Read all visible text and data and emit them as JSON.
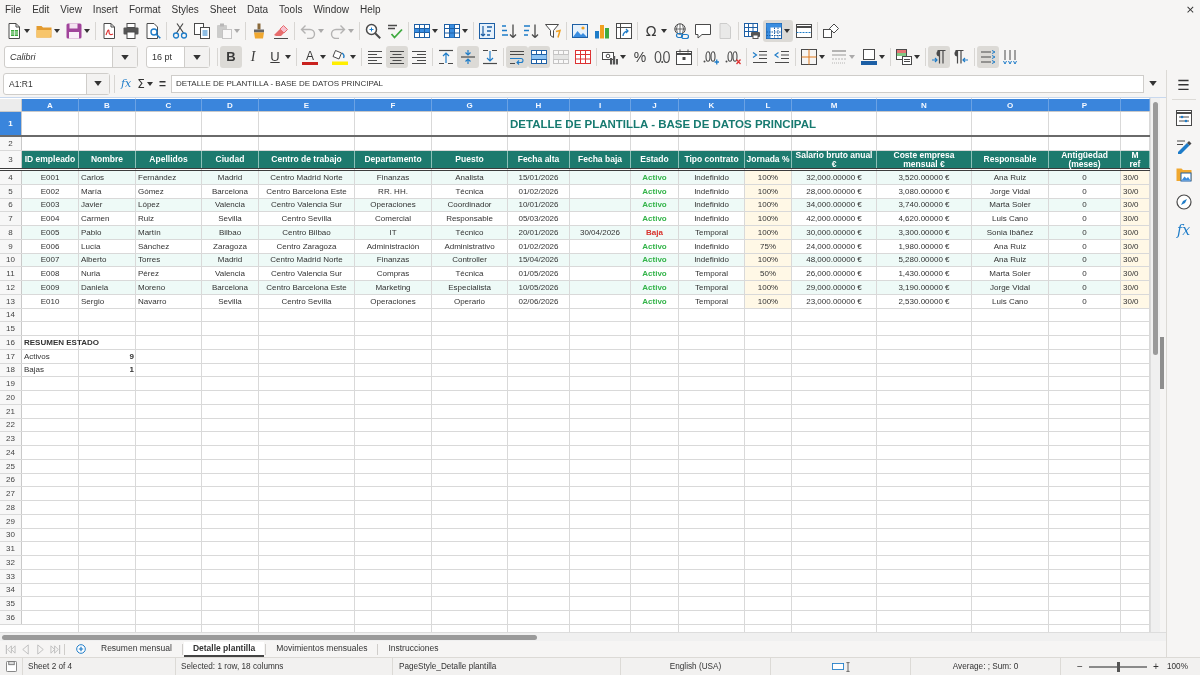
{
  "menu_bar": {
    "items": [
      "File",
      "Edit",
      "View",
      "Insert",
      "Format",
      "Styles",
      "Sheet",
      "Data",
      "Tools",
      "Window",
      "Help"
    ],
    "close": "×"
  },
  "standard_toolbar": [
    [
      {
        "kind": "new",
        "selected": false,
        "disabled": false
      },
      {
        "kind": "open",
        "selected": false,
        "disabled": false
      },
      {
        "kind": "save",
        "selected": false,
        "disabled": false
      }
    ],
    [
      {
        "kind": "pdf",
        "selected": false,
        "disabled": false
      },
      {
        "kind": "print",
        "selected": false,
        "disabled": false
      },
      {
        "kind": "preview",
        "selected": false,
        "disabled": false
      }
    ],
    [
      {
        "kind": "cut",
        "selected": false,
        "disabled": false
      },
      {
        "kind": "copy",
        "selected": false,
        "disabled": false
      },
      {
        "kind": "paste",
        "selected": false,
        "disabled": true
      }
    ],
    [
      {
        "kind": "clone",
        "selected": false,
        "disabled": false
      },
      {
        "kind": "clear",
        "selected": false,
        "disabled": false
      }
    ],
    [
      {
        "kind": "undo",
        "selected": false,
        "disabled": true
      },
      {
        "kind": "redo",
        "selected": false,
        "disabled": true
      }
    ],
    [
      {
        "kind": "find",
        "selected": false,
        "disabled": false
      },
      {
        "kind": "spelling",
        "selected": false,
        "disabled": false
      }
    ],
    [
      {
        "kind": "rows",
        "selected": false,
        "disabled": false
      },
      {
        "kind": "columns",
        "selected": false,
        "disabled": false
      }
    ],
    [
      {
        "kind": "sort",
        "selected": false,
        "disabled": false
      },
      {
        "kind": "ascending",
        "selected": false,
        "disabled": false
      },
      {
        "kind": "descending",
        "selected": false,
        "disabled": false
      },
      {
        "kind": "autofilter",
        "selected": false,
        "disabled": false
      }
    ],
    [
      {
        "kind": "image",
        "selected": false,
        "disabled": false
      },
      {
        "kind": "chart",
        "selected": false,
        "disabled": false
      },
      {
        "kind": "pivot",
        "selected": false,
        "disabled": false
      }
    ],
    [
      {
        "kind": "symbol",
        "glyph": "Ω",
        "selected": false,
        "disabled": false
      },
      {
        "kind": "hyperlink",
        "selected": false,
        "disabled": false
      },
      {
        "kind": "comment",
        "selected": false,
        "disabled": false
      },
      {
        "kind": "headerfooter",
        "selected": false,
        "disabled": true
      }
    ],
    [
      {
        "kind": "printarea",
        "selected": false,
        "disabled": false
      },
      {
        "kind": "freeze",
        "selected": true,
        "disabled": false
      },
      {
        "kind": "split",
        "selected": false,
        "disabled": false
      }
    ],
    [
      {
        "kind": "shapes",
        "selected": false,
        "disabled": false
      }
    ]
  ],
  "formatting_toolbar": {
    "font_name": "Calibri",
    "font_size": "16 pt",
    "groups": [
      [
        {
          "kind": "bold",
          "glyph": "B",
          "selected": true,
          "disabled": false
        },
        {
          "kind": "italic",
          "glyph": "I",
          "selected": false,
          "disabled": false
        },
        {
          "kind": "underline",
          "glyph": "U",
          "selected": false,
          "disabled": false
        }
      ],
      [
        {
          "kind": "fontcolor",
          "glyph": "A",
          "selected": false,
          "disabled": false
        },
        {
          "kind": "highlight",
          "selected": false,
          "disabled": false
        }
      ],
      [
        {
          "kind": "left",
          "selected": false,
          "disabled": false
        },
        {
          "kind": "center",
          "selected": true,
          "disabled": false
        },
        {
          "kind": "right",
          "selected": false,
          "disabled": false
        }
      ],
      [
        {
          "kind": "top",
          "selected": false,
          "disabled": false
        },
        {
          "kind": "middle",
          "selected": true,
          "disabled": false
        },
        {
          "kind": "bottom",
          "selected": false,
          "disabled": false
        }
      ],
      [
        {
          "kind": "wrap",
          "selected": true,
          "disabled": false
        },
        {
          "kind": "mergecenter",
          "selected": true,
          "disabled": false
        },
        {
          "kind": "merge",
          "selected": false,
          "disabled": true
        },
        {
          "kind": "unmerge",
          "selected": false,
          "disabled": false
        }
      ],
      [
        {
          "kind": "currency",
          "selected": false,
          "disabled": false
        },
        {
          "kind": "percent",
          "glyph": "%",
          "selected": false,
          "disabled": false
        },
        {
          "kind": "number",
          "selected": false,
          "disabled": false
        },
        {
          "kind": "date",
          "selected": false,
          "disabled": false
        }
      ],
      [
        {
          "kind": "adddecimal",
          "selected": false,
          "disabled": false
        },
        {
          "kind": "deletedecimal",
          "selected": false,
          "disabled": false
        }
      ],
      [
        {
          "kind": "indent",
          "selected": false,
          "disabled": false
        },
        {
          "kind": "outdent",
          "selected": false,
          "disabled": false
        }
      ],
      [
        {
          "kind": "borders",
          "selected": false,
          "disabled": false
        },
        {
          "kind": "borderstyle",
          "selected": false,
          "disabled": true
        },
        {
          "kind": "bordercolor",
          "selected": false,
          "disabled": false
        }
      ],
      [
        {
          "kind": "conditional",
          "selected": false,
          "disabled": false
        }
      ],
      [
        {
          "kind": "ltr",
          "selected": true,
          "disabled": false
        },
        {
          "kind": "rtl",
          "selected": false,
          "disabled": false
        }
      ],
      [
        {
          "kind": "horizontal",
          "selected": true,
          "disabled": false
        },
        {
          "kind": "vertical",
          "selected": false,
          "disabled": false
        }
      ]
    ]
  },
  "formula_bar": {
    "name_box": "A1:R1",
    "buttons": [
      {
        "kind": "function",
        "glyph": "fx"
      },
      {
        "kind": "sum",
        "glyph": "Σ"
      },
      {
        "kind": "formula",
        "glyph": "="
      }
    ],
    "content": "DETALLE DE PLANTILLA - BASE DE DATOS PRINCIPAL"
  },
  "sheet": {
    "column_headers": [
      {
        "label": "A",
        "selected": true
      },
      {
        "label": "B",
        "selected": true
      },
      {
        "label": "C",
        "selected": true
      },
      {
        "label": "D",
        "selected": true
      },
      {
        "label": "E",
        "selected": true
      },
      {
        "label": "F",
        "selected": true
      },
      {
        "label": "G",
        "selected": true
      },
      {
        "label": "H",
        "selected": true
      },
      {
        "label": "I",
        "selected": true
      },
      {
        "label": "J",
        "selected": true
      },
      {
        "label": "K",
        "selected": true
      },
      {
        "label": "L",
        "selected": true
      },
      {
        "label": "M",
        "selected": true
      },
      {
        "label": "N",
        "selected": true
      },
      {
        "label": "O",
        "selected": true
      },
      {
        "label": "P",
        "selected": true
      }
    ],
    "row_headers": [
      {
        "label": "1",
        "selected": true
      },
      {
        "label": "2",
        "selected": false
      },
      {
        "label": "3",
        "selected": false
      },
      {
        "label": "4",
        "selected": false
      },
      {
        "label": "5",
        "selected": false
      },
      {
        "label": "6",
        "selected": false
      },
      {
        "label": "7",
        "selected": false
      },
      {
        "label": "8",
        "selected": false
      },
      {
        "label": "9",
        "selected": false
      },
      {
        "label": "10",
        "selected": false
      },
      {
        "label": "11",
        "selected": false
      },
      {
        "label": "12",
        "selected": false
      },
      {
        "label": "13",
        "selected": false
      },
      {
        "label": "14",
        "selected": false
      },
      {
        "label": "15",
        "selected": false
      },
      {
        "label": "16",
        "selected": false
      },
      {
        "label": "17",
        "selected": false
      },
      {
        "label": "18",
        "selected": false
      },
      {
        "label": "19",
        "selected": false
      },
      {
        "label": "20",
        "selected": false
      },
      {
        "label": "21",
        "selected": false
      },
      {
        "label": "22",
        "selected": false
      },
      {
        "label": "23",
        "selected": false
      },
      {
        "label": "24",
        "selected": false
      },
      {
        "label": "25",
        "selected": false
      },
      {
        "label": "26",
        "selected": false
      },
      {
        "label": "27",
        "selected": false
      },
      {
        "label": "28",
        "selected": false
      },
      {
        "label": "29",
        "selected": false
      },
      {
        "label": "30",
        "selected": false
      },
      {
        "label": "31",
        "selected": false
      },
      {
        "label": "32",
        "selected": false
      },
      {
        "label": "33",
        "selected": false
      },
      {
        "label": "34",
        "selected": false
      },
      {
        "label": "35",
        "selected": false
      },
      {
        "label": "36",
        "selected": false
      }
    ],
    "title": "DETALLE DE PLANTILLA - BASE DE DATOS PRINCIPAL",
    "table": {
      "columns": [
        "ID empleado",
        "Nombre",
        "Apellidos",
        "Ciudad",
        "Centro de trabajo",
        "Departamento",
        "Puesto",
        "Fecha alta",
        "Fecha baja",
        "Estado",
        "Tipo contrato",
        "Jornada %",
        "Salario bruto anual €",
        "Coste empresa mensual €",
        "Responsable",
        "Antigüedad (meses)",
        "M\nref"
      ],
      "rows": [
        {
          "id": "E001",
          "nombre": "Carlos",
          "apellidos": "Fernández",
          "ciudad": "Madrid",
          "centro_trabajo": "Centro Madrid Norte",
          "departamento": "Finanzas",
          "puesto": "Analista",
          "fecha_alta": "15/01/2026",
          "estado": {
            "label": "Activo",
            "color": "#34b44a"
          },
          "tipo_contrato": "Indefinido",
          "jornada": "100%",
          "salario_bruto_anual": "32,000.00000 €",
          "coste_empresa_mensual": "3,520.00000 €",
          "responsable": "Ana Ruiz",
          "antiguedad": "0",
          "column_17": "30/0"
        },
        {
          "id": "E002",
          "nombre": "María",
          "apellidos": "Gómez",
          "ciudad": "Barcelona",
          "centro_trabajo": "Centro Barcelona Este",
          "departamento": "RR. HH.",
          "puesto": "Técnica",
          "fecha_alta": "01/02/2026",
          "estado": {
            "label": "Activo",
            "color": "#34b44a"
          },
          "tipo_contrato": "Indefinido",
          "jornada": "100%",
          "salario_bruto_anual": "28,000.00000 €",
          "coste_empresa_mensual": "3,080.00000 €",
          "responsable": "Jorge Vidal",
          "antiguedad": "0",
          "column_17": "30/0"
        },
        {
          "id": "E003",
          "nombre": "Javier",
          "apellidos": "López",
          "ciudad": "Valencia",
          "centro_trabajo": "Centro Valencia Sur",
          "departamento": "Operaciones",
          "puesto": "Coordinador",
          "fecha_alta": "10/01/2026",
          "estado": {
            "label": "Activo",
            "color": "#34b44a"
          },
          "tipo_contrato": "Indefinido",
          "jornada": "100%",
          "salario_bruto_anual": "34,000.00000 €",
          "coste_empresa_mensual": "3,740.00000 €",
          "responsable": "Marta Soler",
          "antiguedad": "0",
          "column_17": "30/0"
        },
        {
          "id": "E004",
          "nombre": "Carmen",
          "apellidos": "Ruiz",
          "ciudad": "Sevilla",
          "centro_trabajo": "Centro Sevilla",
          "departamento": "Comercial",
          "puesto": "Responsable",
          "fecha_alta": "05/03/2026",
          "estado": {
            "label": "Activo",
            "color": "#34b44a"
          },
          "tipo_contrato": "Indefinido",
          "jornada": "100%",
          "salario_bruto_anual": "42,000.00000 €",
          "coste_empresa_mensual": "4,620.00000 €",
          "responsable": "Luis Cano",
          "antiguedad": "0",
          "column_17": "30/0"
        },
        {
          "id": "E005",
          "nombre": "Pablo",
          "apellidos": "Martín",
          "ciudad": "Bilbao",
          "centro_trabajo": "Centro Bilbao",
          "departamento": "IT",
          "puesto": "Técnico",
          "fecha_alta": "20/01/2026",
          "fecha_baja": "30/04/2026",
          "estado": {
            "label": "Baja",
            "color": "#d8312b"
          },
          "tipo_contrato": "Temporal",
          "jornada": "100%",
          "salario_bruto_anual": "30,000.00000 €",
          "coste_empresa_mensual": "3,300.00000 €",
          "responsable": "Sonia Ibáñez",
          "antiguedad": "0",
          "column_17": "30/0"
        },
        {
          "id": "E006",
          "nombre": "Lucía",
          "apellidos": "Sánchez",
          "ciudad": "Zaragoza",
          "centro_trabajo": "Centro Zaragoza",
          "departamento": "Administración",
          "puesto": "Administrativo",
          "fecha_alta": "01/02/2026",
          "estado": {
            "label": "Activo",
            "color": "#34b44a"
          },
          "tipo_contrato": "Indefinido",
          "jornada": "75%",
          "salario_bruto_anual": "24,000.00000 €",
          "coste_empresa_mensual": "1,980.00000 €",
          "responsable": "Ana Ruiz",
          "antiguedad": "0",
          "column_17": "30/0"
        },
        {
          "id": "E007",
          "nombre": "Alberto",
          "apellidos": "Torres",
          "ciudad": "Madrid",
          "centro_trabajo": "Centro Madrid Norte",
          "departamento": "Finanzas",
          "puesto": "Controller",
          "fecha_alta": "15/04/2026",
          "estado": {
            "label": "Activo",
            "color": "#34b44a"
          },
          "tipo_contrato": "Indefinido",
          "jornada": "100%",
          "salario_bruto_anual": "48,000.00000 €",
          "coste_empresa_mensual": "5,280.00000 €",
          "responsable": "Ana Ruiz",
          "antiguedad": "0",
          "column_17": "30/0"
        },
        {
          "id": "E008",
          "nombre": "Nuria",
          "apellidos": "Pérez",
          "ciudad": "Valencia",
          "centro_trabajo": "Centro Valencia Sur",
          "departamento": "Compras",
          "puesto": "Técnica",
          "fecha_alta": "01/05/2026",
          "estado": {
            "label": "Activo",
            "color": "#34b44a"
          },
          "tipo_contrato": "Temporal",
          "jornada": "50%",
          "salario_bruto_anual": "26,000.00000 €",
          "coste_empresa_mensual": "1,430.00000 €",
          "responsable": "Marta Soler",
          "antiguedad": "0",
          "column_17": "30/0"
        },
        {
          "id": "E009",
          "nombre": "Daniela",
          "apellidos": "Moreno",
          "ciudad": "Barcelona",
          "centro_trabajo": "Centro Barcelona Este",
          "departamento": "Marketing",
          "puesto": "Especialista",
          "fecha_alta": "10/05/2026",
          "estado": {
            "label": "Activo",
            "color": "#34b44a"
          },
          "tipo_contrato": "Temporal",
          "jornada": "100%",
          "salario_bruto_anual": "29,000.00000 €",
          "coste_empresa_mensual": "3,190.00000 €",
          "responsable": "Jorge Vidal",
          "antiguedad": "0",
          "column_17": "30/0"
        },
        {
          "id": "E010",
          "nombre": "Sergio",
          "apellidos": "Navarro",
          "ciudad": "Sevilla",
          "centro_trabajo": "Centro Sevilla",
          "departamento": "Operaciones",
          "puesto": "Operario",
          "fecha_alta": "02/06/2026",
          "estado": {
            "label": "Activo",
            "color": "#34b44a"
          },
          "tipo_contrato": "Temporal",
          "jornada": "100%",
          "salario_bruto_anual": "23,000.00000 €",
          "coste_empresa_mensual": "2,530.00000 €",
          "responsable": "Luis Cano",
          "antiguedad": "0",
          "column_17": "30/0"
        }
      ]
    },
    "summary": {
      "title": "RESUMEN ESTADO",
      "rows": [
        {
          "label": "Activos",
          "value": "9"
        },
        {
          "label": "Bajas",
          "value": "1"
        }
      ]
    }
  },
  "sheet_tabs": {
    "navigation_disabled": true,
    "tabs": [
      {
        "label": "Resumen mensual",
        "selected": false
      },
      {
        "label": "Detalle plantilla",
        "selected": true
      },
      {
        "label": "Movimientos mensuales",
        "selected": false
      },
      {
        "label": "Instrucciones",
        "selected": false
      }
    ]
  },
  "sidebar": [
    {
      "kind": "menu",
      "glyph": "☰"
    },
    {
      "kind": "properties"
    },
    {
      "kind": "styles"
    },
    {
      "kind": "gallery"
    },
    {
      "kind": "navigator"
    },
    {
      "kind": "functions",
      "glyph": "fx"
    }
  ],
  "status_bar": {
    "sheet": "Sheet 2 of 4",
    "selection": "Selected: 1 row, 18 columns",
    "page_style": "PageStyle_Detalle plantilla",
    "language": "English (USA)",
    "summary": "Average: ; Sum: 0",
    "zoom": {
      "out": "−",
      "level": 0.5,
      "in": "+",
      "value": "100%"
    }
  }
}
